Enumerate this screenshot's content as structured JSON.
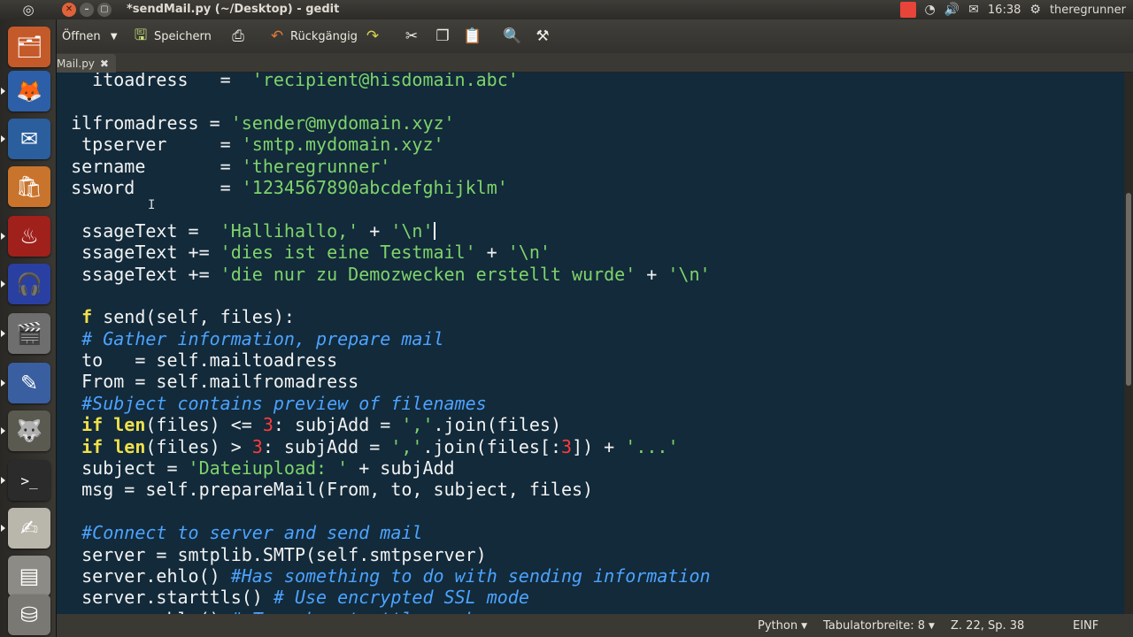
{
  "top_panel": {
    "window_title": "*sendMail.py (~/Desktop) - gedit",
    "window_buttons": [
      "close-icon",
      "minimize-icon",
      "maximize-icon"
    ],
    "clock": "16:38",
    "user": "theregrunner",
    "indicator_icons": [
      "notification-red-icon",
      "wifi-icon",
      "volume-icon",
      "mail-icon",
      "session-gear-icon"
    ]
  },
  "launcher": {
    "items": [
      {
        "name": "files-icon",
        "glyph": "🗂",
        "bg": "#c45a2a"
      },
      {
        "name": "firefox-icon",
        "glyph": "🦊",
        "bg": "#2d5fa8"
      },
      {
        "name": "thunderbird-icon",
        "glyph": "✉",
        "bg": "#2b5e9c"
      },
      {
        "name": "software-center-icon",
        "glyph": "🛍",
        "bg": "#c9742c"
      },
      {
        "name": "red-app-icon",
        "glyph": "♨",
        "bg": "#a0201c"
      },
      {
        "name": "audacity-icon",
        "glyph": "🎧",
        "bg": "#2a3fa2"
      },
      {
        "name": "video-editor-icon",
        "glyph": "🎬",
        "bg": "#6e6e6e"
      },
      {
        "name": "pencil-app-icon",
        "glyph": "✎",
        "bg": "#3a5fa0"
      },
      {
        "name": "gimp-icon",
        "glyph": "🐺",
        "bg": "#5b5a50"
      },
      {
        "name": "terminal-icon",
        "glyph": ">_",
        "bg": "#2b2b2b"
      },
      {
        "name": "gedit-icon",
        "glyph": "✍",
        "bg": "#b9b6ac"
      },
      {
        "name": "settings-panel-icon",
        "glyph": "▤",
        "bg": "#8d8b85"
      },
      {
        "name": "usb-drive-icon",
        "glyph": "⛁",
        "bg": "#7a7873"
      }
    ]
  },
  "toolbar": {
    "open_label": "Öffnen",
    "save_label": "Speichern",
    "undo_label": "Rückgängig"
  },
  "tab": {
    "label": "Mail.py",
    "close": "✖"
  },
  "code_lines": [
    [
      [
        "p",
        "    itoadress   =  "
      ],
      [
        "s",
        "'recipient@hisdomain.abc'"
      ]
    ],
    [
      [
        "p",
        ""
      ]
    ],
    [
      [
        "p",
        "  ilfromadress = "
      ],
      [
        "s",
        "'sender@mydomain.xyz'"
      ]
    ],
    [
      [
        "p",
        "   tpserver     = "
      ],
      [
        "s",
        "'smtp.mydomain.xyz'"
      ]
    ],
    [
      [
        "p",
        "  sername       = "
      ],
      [
        "s",
        "'theregrunner'"
      ]
    ],
    [
      [
        "p",
        "  ssword        = "
      ],
      [
        "s",
        "'1234567890abcdefghijklm'"
      ]
    ],
    [
      [
        "p",
        ""
      ]
    ],
    [
      [
        "p",
        "   ssageText =  "
      ],
      [
        "s",
        "'Hallihallo,'"
      ],
      [
        "p",
        " + "
      ],
      [
        "s",
        "'\\n'"
      ],
      [
        "c",
        ""
      ]
    ],
    [
      [
        "p",
        "   ssageText += "
      ],
      [
        "s",
        "'dies ist eine Testmail'"
      ],
      [
        "p",
        " + "
      ],
      [
        "s",
        "'\\n'"
      ]
    ],
    [
      [
        "p",
        "   ssageText += "
      ],
      [
        "s",
        "'die nur zu Demozwecken erstellt wurde'"
      ],
      [
        "p",
        " + "
      ],
      [
        "s",
        "'\\n'"
      ]
    ],
    [
      [
        "p",
        ""
      ]
    ],
    [
      [
        "k",
        "   f"
      ],
      [
        "p",
        " send(self, files):"
      ]
    ],
    [
      [
        "m",
        "   # Gather information, prepare mail"
      ]
    ],
    [
      [
        "p",
        "   to   = self.mailtoadress"
      ]
    ],
    [
      [
        "p",
        "   From = self.mailfromadress"
      ]
    ],
    [
      [
        "m",
        "   #Subject contains preview of filenames"
      ]
    ],
    [
      [
        "k",
        "   if len"
      ],
      [
        "p",
        "(files) <= "
      ],
      [
        "n",
        "3"
      ],
      [
        "p",
        ": subjAdd = "
      ],
      [
        "s",
        "','"
      ],
      [
        "p",
        ".join(files)"
      ]
    ],
    [
      [
        "k",
        "   if len"
      ],
      [
        "p",
        "(files) > "
      ],
      [
        "n",
        "3"
      ],
      [
        "p",
        ": subjAdd = "
      ],
      [
        "s",
        "','"
      ],
      [
        "p",
        ".join(files[:"
      ],
      [
        "n",
        "3"
      ],
      [
        "p",
        "]) + "
      ],
      [
        "s",
        "'...'"
      ]
    ],
    [
      [
        "p",
        "   subject = "
      ],
      [
        "s",
        "'Dateiupload: '"
      ],
      [
        "p",
        " + subjAdd"
      ]
    ],
    [
      [
        "p",
        "   msg = self.prepareMail(From, to, subject, files)"
      ]
    ],
    [
      [
        "p",
        ""
      ]
    ],
    [
      [
        "m",
        "   #Connect to server and send mail"
      ]
    ],
    [
      [
        "p",
        "   server = smtplib.SMTP(self.smtpserver)"
      ]
    ],
    [
      [
        "p",
        "   server.ehlo() "
      ],
      [
        "m",
        "#Has something to do with sending information"
      ]
    ],
    [
      [
        "p",
        "   server.starttls() "
      ],
      [
        "m",
        "# Use encrypted SSL mode"
      ]
    ],
    [
      [
        "p",
        "   server.ehlo() "
      ],
      [
        "m",
        "# To make starttls work"
      ]
    ]
  ],
  "status_bar": {
    "language": "Python",
    "tab_width": "Tabulatorbreite: 8",
    "position": "Z. 22, Sp. 38",
    "mode": "EINF"
  },
  "colors": {
    "editor_bg": "#122a3a",
    "string": "#7fd36b",
    "comment": "#4da3ff",
    "keyword": "#f0e04a",
    "number": "#ff3a3a"
  }
}
